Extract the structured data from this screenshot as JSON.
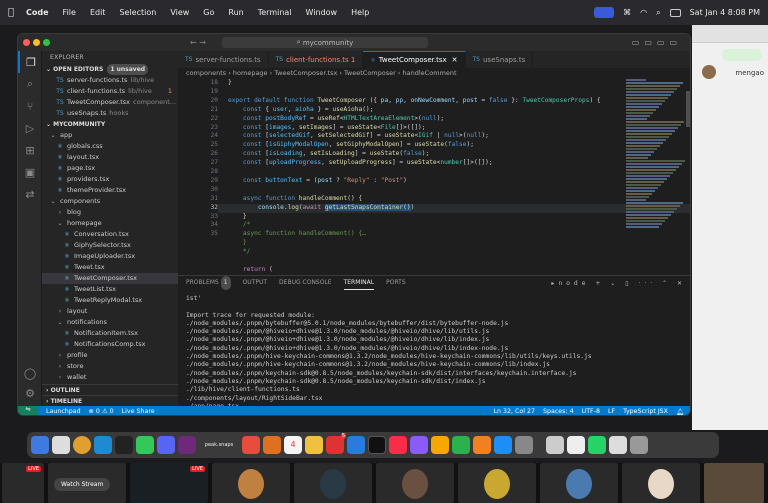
{
  "menubar": {
    "app": "Code",
    "items": [
      "File",
      "Edit",
      "Selection",
      "View",
      "Go",
      "Run",
      "Terminal",
      "Window",
      "Help"
    ],
    "datetime": "Sat Jan 4  8:08 PM"
  },
  "bg_app": {
    "name": "mengao"
  },
  "titlebar": {
    "search": "mycommunity"
  },
  "explorer": {
    "title": "EXPLORER",
    "open_editors_label": "OPEN EDITORS",
    "unsaved_badge": "1 unsaved",
    "open_editors": [
      {
        "name": "server-functions.ts",
        "desc": "lib/hive",
        "mark": ""
      },
      {
        "name": "client-functions.ts",
        "desc": "lib/hive",
        "mark": "1"
      },
      {
        "name": "TweetComposer.tsx",
        "desc": "component...",
        "mark": ""
      },
      {
        "name": "useSnaps.ts",
        "desc": "hooks",
        "mark": ""
      }
    ],
    "project_label": "MYCOMMUNITY",
    "tree": [
      {
        "name": "app",
        "depth": 1,
        "folder": true
      },
      {
        "name": "globals.css",
        "depth": 2
      },
      {
        "name": "layout.tsx",
        "depth": 2
      },
      {
        "name": "page.tsx",
        "depth": 2
      },
      {
        "name": "providers.tsx",
        "depth": 2
      },
      {
        "name": "themeProvider.tsx",
        "depth": 2
      },
      {
        "name": "components",
        "depth": 1,
        "folder": true
      },
      {
        "name": "blog",
        "depth": 2,
        "folder": true
      },
      {
        "name": "homepage",
        "depth": 2,
        "folder": true
      },
      {
        "name": "Conversation.tsx",
        "depth": 3
      },
      {
        "name": "GiphySelector.tsx",
        "depth": 3
      },
      {
        "name": "ImageUploader.tsx",
        "depth": 3
      },
      {
        "name": "Tweet.tsx",
        "depth": 3
      },
      {
        "name": "TweetComposer.tsx",
        "depth": 3,
        "selected": true
      },
      {
        "name": "TweetList.tsx",
        "depth": 3
      },
      {
        "name": "TweetReplyModal.tsx",
        "depth": 3
      },
      {
        "name": "layout",
        "depth": 2,
        "folder": true
      },
      {
        "name": "notifications",
        "depth": 2,
        "folder": true
      },
      {
        "name": "NotificationItem.tsx",
        "depth": 3
      },
      {
        "name": "NotificationsComp.tsx",
        "depth": 3
      },
      {
        "name": "profile",
        "depth": 2,
        "folder": true
      },
      {
        "name": "store",
        "depth": 2,
        "folder": true
      },
      {
        "name": "wallet",
        "depth": 2,
        "folder": true
      }
    ],
    "outline_label": "OUTLINE",
    "timeline_label": "TIMELINE"
  },
  "tabs": [
    {
      "label": "server-functions.ts",
      "active": false
    },
    {
      "label": "client-functions.ts 1",
      "active": false,
      "error": true
    },
    {
      "label": "TweetComposer.tsx",
      "active": true
    },
    {
      "label": "useSnaps.ts",
      "active": false
    }
  ],
  "breadcrumb": "components › homepage › TweetComposer.tsx › TweetComposer › handleComment",
  "code_lines": [
    {
      "n": "18",
      "html": "}"
    },
    {
      "n": "19",
      "html": ""
    },
    {
      "n": "20",
      "html": "<span class='k'>export default function</span> <span class='f'>TweetComposer</span> ({ <span class='v'>pa</span>, <span class='v'>pp</span>, <span class='v'>onNewComment</span>, <span class='v'>post</span> = <span class='k'>false</span> }: <span class='t'>TweetComposerProps</span>) {"
    },
    {
      "n": "21",
      "html": "    <span class='k'>const</span> { <span class='c2'>user</span>, <span class='c2'>aioha</span> } = <span class='f'>useAioha</span>();"
    },
    {
      "n": "22",
      "html": "    <span class='k'>const</span> <span class='c2'>postBodyRef</span> = <span class='f'>useRef</span>&lt;<span class='t'>HTMLTextAreaElement</span>&gt;(<span class='k'>null</span>);"
    },
    {
      "n": "23",
      "html": "    <span class='k'>const</span> [<span class='c2'>images</span>, <span class='f'>setImages</span>] = <span class='f'>useState</span>&lt;<span class='t'>File</span>[]&gt;([]);"
    },
    {
      "n": "24",
      "html": "    <span class='k'>const</span> [<span class='c2'>selectedGif</span>, <span class='f'>setSelectedGif</span>] = <span class='f'>useState</span>&lt;<span class='t'>IGif</span> | <span class='k'>null</span>&gt;(<span class='k'>null</span>);"
    },
    {
      "n": "25",
      "html": "    <span class='k'>const</span> [<span class='c2'>isGiphyModalOpen</span>, <span class='f'>setGiphyModalOpen</span>] = <span class='f'>useState</span>(<span class='k'>false</span>);"
    },
    {
      "n": "26",
      "html": "    <span class='k'>const</span> [<span class='c2'>isLoading</span>, <span class='f'>setIsLoading</span>] = <span class='f'>useState</span>(<span class='k'>false</span>);"
    },
    {
      "n": "27",
      "html": "    <span class='k'>const</span> [<span class='c2'>uploadProgress</span>, <span class='f'>setUploadProgress</span>] = <span class='f'>useState</span>&lt;<span class='t'>number</span>[]&gt;([]);"
    },
    {
      "n": "28",
      "html": ""
    },
    {
      "n": "29",
      "html": "    <span class='k'>const</span> <span class='c2'>buttonText</span> = (<span class='v'>post</span> ? <span class='s'>\"Reply\"</span> : <span class='s'>\"Post\"</span>)"
    },
    {
      "n": "30",
      "html": ""
    },
    {
      "n": "31",
      "html": "    <span class='k'>async function</span> <span class='f'>handleComment</span>() {"
    },
    {
      "n": "32",
      "html": "        <span class='v'>console</span>.<span class='f'>log</span>(<span class='p'>await</span> <span class='hl'><span class='f'>getLastSnapsContainer</span>()</span>)",
      "current": true
    },
    {
      "n": "33",
      "html": "    }"
    },
    {
      "n": "34",
      "html": "    <span class='c'>/*</span>"
    },
    {
      "n": "35",
      "html": "    <span class='c'>async function handleComment() {…</span>"
    },
    {
      "n": "",
      "html": "    <span class='c'>}</span>"
    },
    {
      "n": "",
      "html": "    <span class='c'>*/</span>"
    },
    {
      "n": "",
      "html": ""
    },
    {
      "n": "",
      "html": "    <span class='p'>return</span> ("
    }
  ],
  "panel": {
    "tabs": [
      {
        "label": "PROBLEMS",
        "badge": "1"
      },
      {
        "label": "OUTPUT"
      },
      {
        "label": "DEBUG CONSOLE"
      },
      {
        "label": "TERMINAL",
        "active": true
      },
      {
        "label": "PORTS"
      }
    ],
    "terminal_name": "node",
    "terminal_text": "ist'\n\nImport trace for requested module:\n./node_modules/.pnpm/bytebuffer@5.0.1/node_modules/bytebuffer/dist/bytebuffer-node.js\n./node_modules/.pnpm/@hiveio+dhive@1.3.0/node_modules/@hiveio/dhive/lib/utils.js\n./node_modules/.pnpm/@hiveio+dhive@1.3.0/node_modules/@hiveio/dhive/lib/index.js\n./node_modules/.pnpm/@hiveio+dhive@1.3.0/node_modules/@hiveio/dhive/lib/index-node.js\n./node_modules/.pnpm/hive-keychain-commons@1.3.2/node_modules/hive-keychain-commons/lib/utils/keys.utils.js\n./node_modules/.pnpm/hive-keychain-commons@1.3.2/node_modules/hive-keychain-commons/lib/index.js\n./node_modules/.pnpm/keychain-sdk@0.8.5/node_modules/keychain-sdk/dist/interfaces/keychain.interface.js\n./node_modules/.pnpm/keychain-sdk@0.8.5/node_modules/keychain-sdk/dist/index.js\n./lib/hive/client-functions.ts\n./components/layout/RightSideBar.tsx\n./app/page.tsx\n▯"
  },
  "status": {
    "launchpad": "Launchpad",
    "problems": "⊗ 0  ⚠ 0",
    "live_share": "Live Share",
    "position": "Ln 32, Col 27",
    "spaces": "Spaces: 4",
    "encoding": "UTF-8",
    "eol": "LF",
    "language": "TypeScript JSX"
  },
  "dock": {
    "app_label": "peak.snaps",
    "calendar_day": "4",
    "badges": {
      "chat": "5"
    }
  },
  "video": {
    "live_label": "LIVE",
    "watch_label": "Watch Stream"
  },
  "colors": {
    "accent": "#007acc",
    "editor_bg": "#1e1e1e",
    "sidebar_bg": "#252526"
  }
}
